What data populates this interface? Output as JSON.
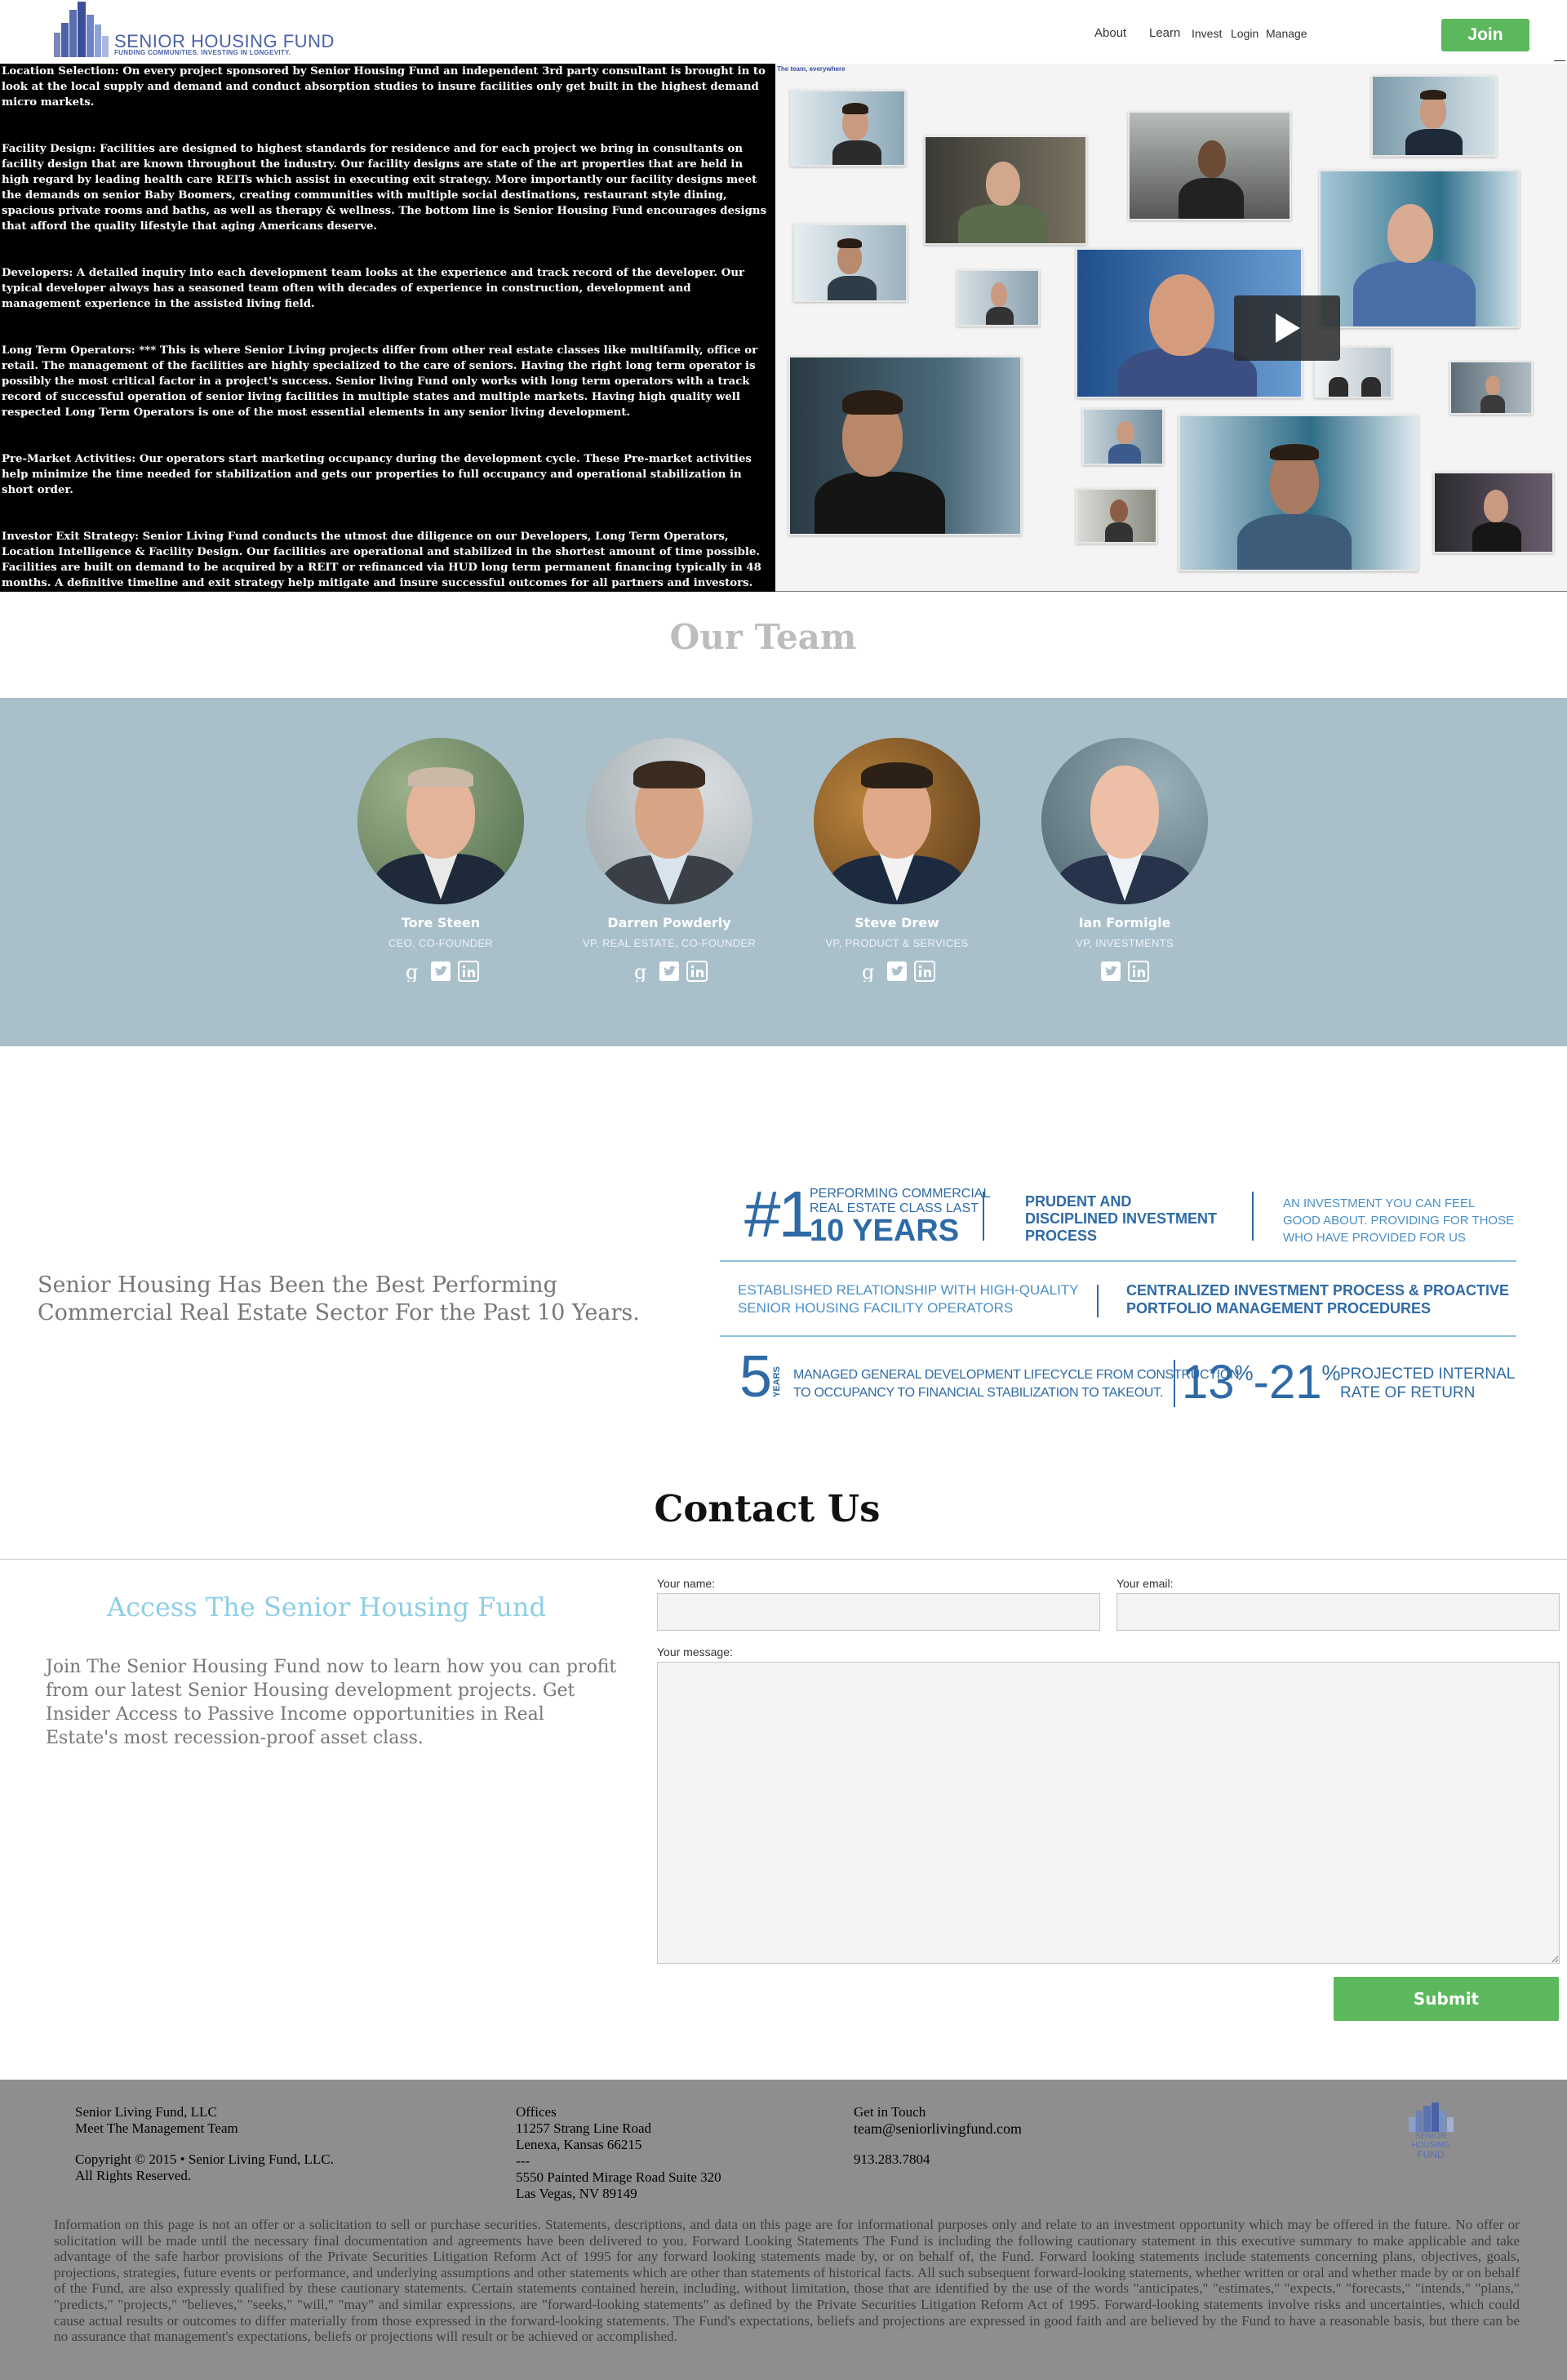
{
  "header": {
    "logo_text": "SENIOR HOUSING FUND",
    "logo_tagline": "FUNDING COMMUNITIES. INVESTING IN LONGEVITY.",
    "nav": [
      "About",
      "Learn",
      "Invest",
      "Login",
      "Manage"
    ],
    "join_label": "Join",
    "accent_color": "#5cb85c",
    "brand_color": "#4a62a8"
  },
  "info": {
    "paragraphs": [
      "Location Selection: On every project sponsored by Senior Housing Fund an independent 3rd party consultant is brought in to look at the local supply and demand and conduct absorption studies to insure facilities only get built in the highest demand micro markets.",
      "Facility Design: Facilities are designed to highest standards for residence and for each project we bring in consultants on facility design that are known throughout the industry. Our facility designs are state of the art properties that are held in high regard by leading health care REITs which assist in executing exit strategy. More importantly our facility designs meet the demands on senior Baby Boomers, creating communities with multiple social destinations, restaurant style dining, spacious private rooms and baths, as well as therapy & wellness. The bottom line is Senior Housing Fund encourages designs that afford the quality lifestyle that aging Americans deserve.",
      "Developers: A detailed inquiry into each development team looks at the experience and track record of the developer. Our typical developer always has a seasoned team often with decades of experience in construction, development and management experience in the assisted living field.",
      "Long Term Operators: *** This is where Senior Living projects differ from other real estate classes like multifamily, office or retail. The management of the facilities are highly specialized to the care of seniors. Having the right long term operator is possibly the most critical factor in a project's success. Senior living Fund only works with long term operators with a track record of successful operation of senior living facilities in multiple states and multiple markets. Having high quality well respected Long Term Operators is one of the most essential elements in any senior living development.",
      "Pre-Market Activities: Our operators start marketing occupancy during the development cycle. These Pre-market activities help minimize the time needed for stabilization and gets our properties to full occupancy and operational stabilization in short order.",
      "Investor Exit Strategy: Senior Living Fund conducts the utmost due diligence on our Developers, Long Term Operators, Location Intelligence & Facility Design. Our facilities are operational and stabilized in the shortest amount of time possible. Facilities are built on demand to be acquired by a REIT or refinanced via HUD long term permanent financing typically in 48 months. A definitive timeline and exit strategy help mitigate and insure successful outcomes for all partners and investors."
    ],
    "video_caption": "The team, everywhere",
    "play_icon": "play-icon"
  },
  "team": {
    "title": "Our Team",
    "band_color": "#a9c0cb",
    "members": [
      {
        "name": "Tore Steen",
        "role": "CEO, CO-FOUNDER"
      },
      {
        "name": "Darren Powderly",
        "role": "VP, REAL ESTATE, CO-FOUNDER"
      },
      {
        "name": "Steve Drew",
        "role": "VP, PRODUCT & SERVICES"
      },
      {
        "name": "Ian Formigle",
        "role": "VP, INVESTMENTS"
      }
    ]
  },
  "stats": {
    "headline": "Senior Housing Has Been the Best Performing Commercial Real Estate Sector For the Past 10 Years.",
    "rank": "#1",
    "rank_line1": "PERFORMING COMMERCIAL",
    "rank_line2": "REAL ESTATE CLASS LAST",
    "rank_years": "10 YEARS",
    "prudent": [
      "PRUDENT AND",
      "DISCIPLINED INVESTMENT",
      "PROCESS"
    ],
    "feel_good": [
      "AN INVESTMENT YOU CAN FEEL",
      "GOOD ABOUT. PROVIDING FOR THOSE",
      "WHO HAVE PROVIDED FOR US"
    ],
    "relationship": [
      "ESTABLISHED RELATIONSHIP WITH HIGH-QUALITY",
      "SENIOR HOUSING FACILITY OPERATORS"
    ],
    "centralized": [
      "CENTRALIZED INVESTMENT PROCESS & PROACTIVE",
      "PORTFOLIO MANAGEMENT PROCEDURES"
    ],
    "five": "5",
    "years_small": "YEARS",
    "lifecycle": [
      "MANAGED GENERAL DEVELOPMENT LIFECYCLE FROM CONSTRUCTION",
      "TO OCCUPANCY TO FINANCIAL STABILIZATION TO TAKEOUT."
    ],
    "irr_low": "13",
    "irr_high": "21",
    "pct": "%",
    "dash": "-",
    "irr_label": [
      "PROJECTED INTERNAL",
      "RATE OF RETURN"
    ]
  },
  "contact": {
    "title": "Contact Us",
    "access_title": "Access The Senior Housing Fund",
    "access_body": "Join The Senior Housing Fund now to learn how you can profit from our latest Senior Housing development projects.  Get Insider Access to Passive Income opportunities in Real Estate's most recession-proof asset class.",
    "name_label": "Your name:",
    "email_label": "Your email:",
    "message_label": "Your message:",
    "name_value": "",
    "email_value": "",
    "message_value": "",
    "submit_label": "Submit"
  },
  "footer": {
    "company": "Senior Living Fund, LLC",
    "team_link": "Meet The Management Team",
    "copyright": "Copyright © 2015 • Senior Living Fund, LLC.",
    "rights": "All Rights Reserved.",
    "offices_title": "Offices",
    "office1_line1": "11257 Strang Line Road",
    "office1_line2": "Lenexa, Kansas 66215",
    "office_sep": "---",
    "office2_line1": "5550 Painted Mirage Road Suite 320",
    "office2_line2": "Las Vegas, NV 89149",
    "touch_title": "Get in Touch",
    "email": "team@seniorlivingfund.com",
    "phone": "913.283.7804",
    "logo_lines": [
      "SENIOR",
      "HOUSING",
      "FUND"
    ],
    "disclaimer": "Information on this page is not an offer or a solicitation to sell or purchase securities. Statements, descriptions, and data on this page are for informational purposes only and relate to an investment opportunity which may be offered in the future. No offer or solicitation will be made until the necessary final documentation and agreements have been delivered to you. Forward Looking Statements  The Fund is including the following cautionary statement in this executive summary to make applicable and take advantage of the safe harbor provisions of the Private Securities Litigation Reform Act of 1995 for any forward looking statements made by, or on behalf of, the Fund. Forward looking statements include statements concerning plans, objectives, goals, projections, strategies, future events or performance, and underlying assumptions and other statements which are other than statements of historical facts. All such subsequent forward-looking statements, whether written or oral and whether made by or on behalf of the Fund, are also expressly qualified by these cautionary statements. Certain statements contained herein, including, without limitation, those that are identified by the use of the words \"anticipates,\" \"estimates,\" \"expects,\" \"forecasts,\" \"intends,\" \"plans,\" \"predicts,\" \"projects,\" \"believes,\" \"seeks,\" \"will,\" \"may\" and similar expressions, are \"forward-looking statements\" as defined by the Private Securities Litigation Reform Act of 1995. Forward-looking statements involve risks and uncertainties, which could cause actual results or outcomes to differ materially from those expressed in the forward-looking statements. The Fund's expectations, beliefs and projections are expressed in good faith and are believed by the Fund to have a reasonable basis, but there can be no assurance that management's expectations, beliefs or projections will result or be achieved or accomplished."
  }
}
